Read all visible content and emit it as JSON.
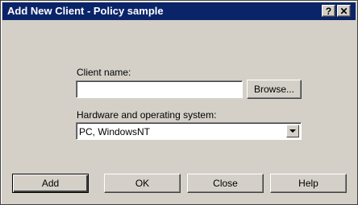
{
  "window": {
    "title": "Add New Client - Policy sample",
    "help_button": "?",
    "close_button": "✕"
  },
  "form": {
    "client_name_label": "Client name:",
    "client_name_value": "",
    "browse_label": "Browse...",
    "hw_os_label": "Hardware and operating system:",
    "hw_os_selected": "PC, WindowsNT"
  },
  "buttons": {
    "add": "Add",
    "ok": "OK",
    "close": "Close",
    "help": "Help"
  }
}
